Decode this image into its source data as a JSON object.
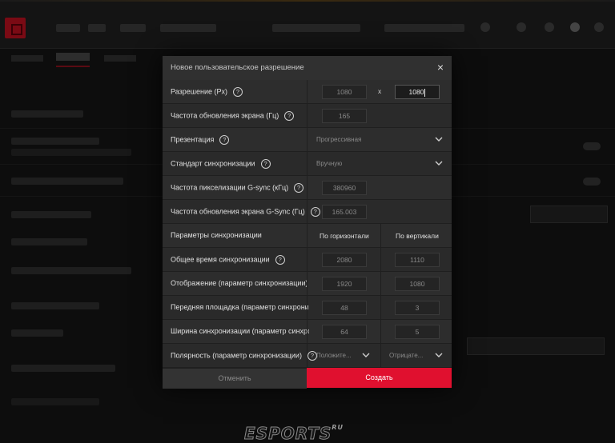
{
  "dialog": {
    "title": "Новое пользовательское разрешение",
    "close_symbol": "×",
    "help_symbol": "?",
    "rows": {
      "resolution": {
        "label": "Разрешение (Px)",
        "width": "1080",
        "separator": "x",
        "height": "1080"
      },
      "refresh_rate": {
        "label": "Частота обновления экрана (Гц)",
        "value": "165"
      },
      "presentation": {
        "label": "Презентация",
        "value": "Прогрессивная"
      },
      "sync_standard": {
        "label": "Стандарт синхронизации",
        "value": "Вручную"
      },
      "gsync_pixel_clock": {
        "label": "Частота пикселизации G-sync (кГц)",
        "value": "380960"
      },
      "gsync_refresh_rate": {
        "label": "Частота обновления экрана G-Sync (Гц)",
        "value": "165.003"
      },
      "sync_params": {
        "label": "Параметры синхронизации",
        "horizontal": "По горизонтали",
        "vertical": "По вертикали"
      },
      "total_sync_time": {
        "label": "Общее время синхронизации",
        "horizontal": "2080",
        "vertical": "1110"
      },
      "display": {
        "label": "Отображение (параметр синхронизации)",
        "horizontal": "1920",
        "vertical": "1080"
      },
      "front_porch": {
        "label": "Передняя площадка (параметр синхронизации)",
        "horizontal": "48",
        "vertical": "3"
      },
      "sync_width": {
        "label": "Ширина синхронизации (параметр синхронизации)",
        "horizontal": "64",
        "vertical": "5"
      },
      "polarity": {
        "label": "Полярность (параметр синхронизации)",
        "horizontal": "Положите...",
        "vertical": "Отрицате..."
      }
    },
    "buttons": {
      "cancel": "Отменить",
      "create": "Создать"
    }
  },
  "watermark": {
    "text": "ESPORTS",
    "suffix": "RU"
  },
  "icons": {
    "close": "close-icon",
    "help": "help-circle-icon",
    "dropdown": "chevron-down-icon"
  },
  "colors": {
    "accent": "#e0102f",
    "dialog_bg": "#2a2a2a",
    "page_bg": "#0d0d0d"
  }
}
